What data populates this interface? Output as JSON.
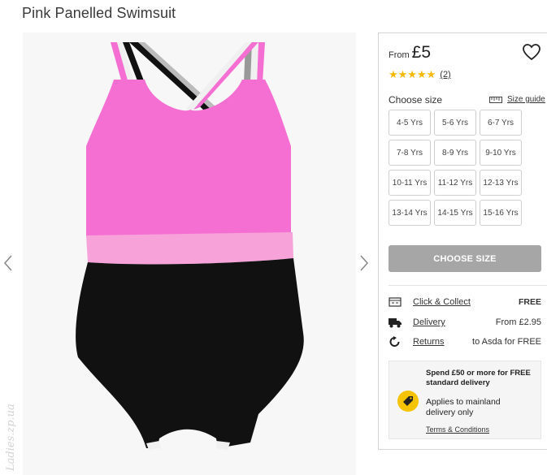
{
  "product": {
    "title": "Pink Panelled Swimsuit"
  },
  "gallery": {
    "prev_icon": "chevron-left-icon",
    "next_icon": "chevron-right-icon",
    "watermark": "Ladies.zp.ua",
    "colors": {
      "pink": "#f56fd3",
      "light_pink": "#f7a3d9",
      "black": "#111111",
      "white": "#f0f0f0",
      "grey": "#999999"
    }
  },
  "panel": {
    "price_from": "From",
    "price": "£5",
    "wishlist_icon": "heart-icon",
    "rating": {
      "stars": "★★★★★",
      "count": "(2)",
      "color": "#f5b800"
    },
    "choose_size_label": "Choose size",
    "size_guide_label": "Size guide",
    "sizes": [
      "4-5 Yrs",
      "5-6 Yrs",
      "6-7 Yrs",
      "7-8 Yrs",
      "8-9 Yrs",
      "9-10 Yrs",
      "10-11 Yrs",
      "11-12 Yrs",
      "12-13 Yrs",
      "13-14 Yrs",
      "14-15 Yrs",
      "15-16 Yrs"
    ],
    "choose_size_button": "CHOOSE SIZE",
    "delivery": [
      {
        "icon": "store-icon",
        "label": "Click & Collect",
        "value": "FREE"
      },
      {
        "icon": "truck-icon",
        "label": "Delivery",
        "value": "From £2.95"
      },
      {
        "icon": "return-icon",
        "label": "Returns",
        "value": "to Asda for FREE"
      }
    ],
    "promo": {
      "headline": "Spend £50 or more for FREE standard delivery",
      "icon": "price-tag-icon",
      "body": "Applies to mainland delivery only",
      "terms": "Terms & Conditions"
    }
  }
}
